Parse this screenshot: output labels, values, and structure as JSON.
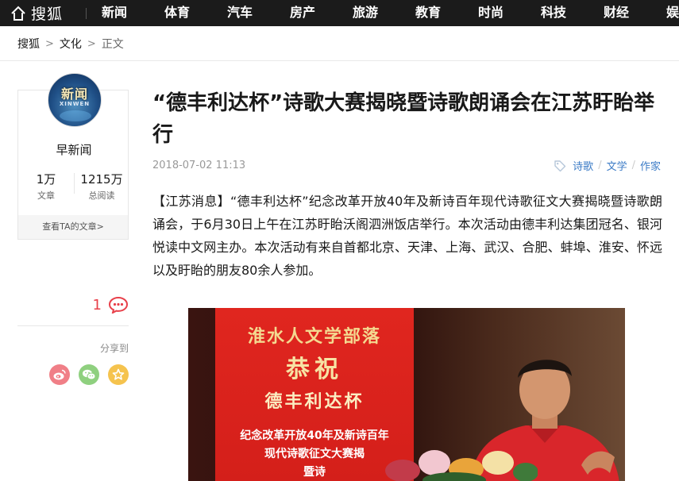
{
  "header": {
    "logo_text": "搜狐",
    "nav": [
      "新闻",
      "体育",
      "汽车",
      "房产",
      "旅游",
      "教育",
      "时尚",
      "科技",
      "财经",
      "娱"
    ]
  },
  "breadcrumb": {
    "items": [
      "搜狐",
      "文化",
      "正文"
    ],
    "separator": ">"
  },
  "author": {
    "avatar_text_cn": "新闻",
    "avatar_text_en": "XINWEN",
    "name": "早新闻",
    "articles_count": "1万",
    "articles_label": "文章",
    "reads_count": "1215万",
    "reads_label": "总阅读",
    "view_more": "查看TA的文章>"
  },
  "comments": {
    "count": "1"
  },
  "share": {
    "label": "分享到"
  },
  "article": {
    "title": "“德丰利达杯”诗歌大赛揭晓暨诗歌朗诵会在江苏盱眙举行",
    "date": "2018-07-02 11:13",
    "tags": [
      "诗歌",
      "文学",
      "作家"
    ],
    "body": "【江苏消息】“德丰利达杯”纪念改革开放40年及新诗百年现代诗歌征文大赛揭晓暨诗歌朗诵会，于6月30日上午在江苏盱眙沃阁泗洲饭店举行。本次活动由德丰利达集团冠名、银河悦读中文网主办。本次活动有来自首都北京、天津、上海、武汉、合肥、蚌埠、淮安、怀远以及盱眙的朋友80余人参加。"
  },
  "photo": {
    "banner_line1": "淮水人文学部落",
    "banner_line2": "恭祝",
    "banner_line3": "德丰利达杯",
    "banner_line4": "纪念改革开放40年及新诗百年",
    "banner_line5": "现代诗歌征文大赛揭",
    "banner_line6": "暨诗"
  },
  "colors": {
    "nav_bg": "#1b1b1b",
    "accent_red": "#e8404a",
    "tag_blue": "#3b7bc6",
    "banner_red": "#d41f1a"
  }
}
